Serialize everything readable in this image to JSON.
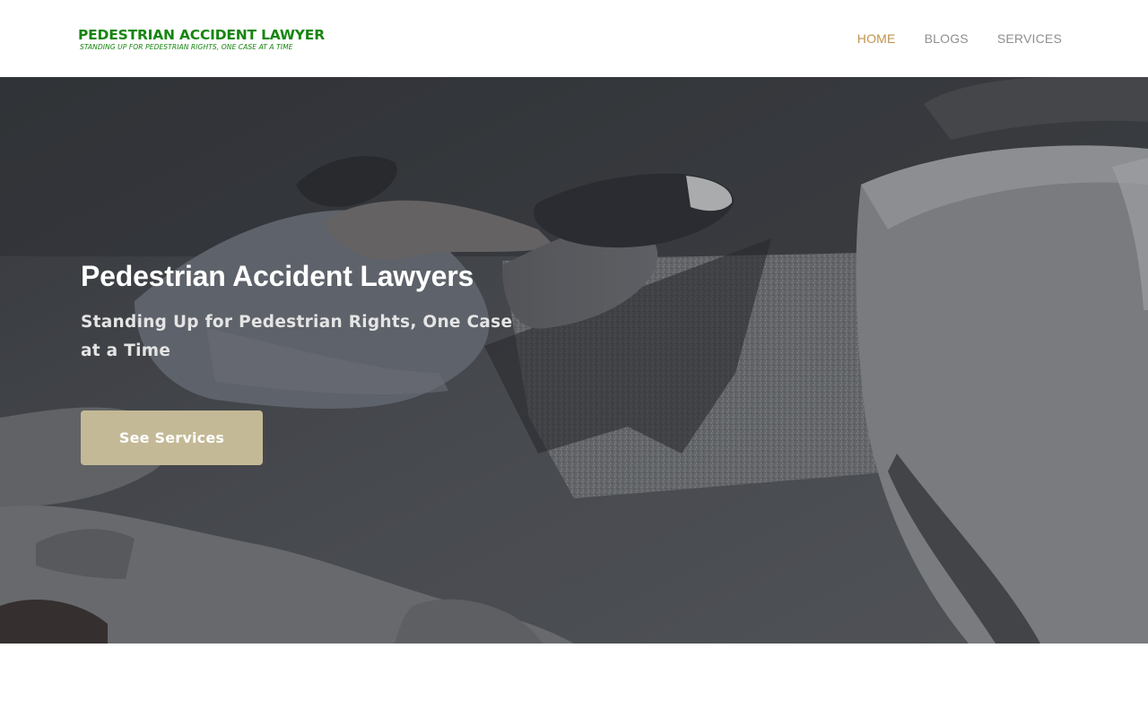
{
  "header": {
    "logo": {
      "title": "PEDESTRIAN ACCIDENT LAWYER",
      "tagline": "STANDING UP FOR PEDESTRIAN RIGHTS, ONE CASE AT A TIME"
    },
    "nav": [
      {
        "label": "HOME",
        "active": true
      },
      {
        "label": "BLOGS",
        "active": false
      },
      {
        "label": "SERVICES",
        "active": false
      }
    ]
  },
  "hero": {
    "title": "Pedestrian Accident Lawyers",
    "subtitle": "Standing Up for Pedestrian Rights, One Case at a Time",
    "cta_label": "See Services"
  },
  "colors": {
    "brand_green": "#16850f",
    "nav_active": "#c0924d",
    "nav_inactive": "#8f8f8f",
    "cta_background": "#c4b996"
  }
}
